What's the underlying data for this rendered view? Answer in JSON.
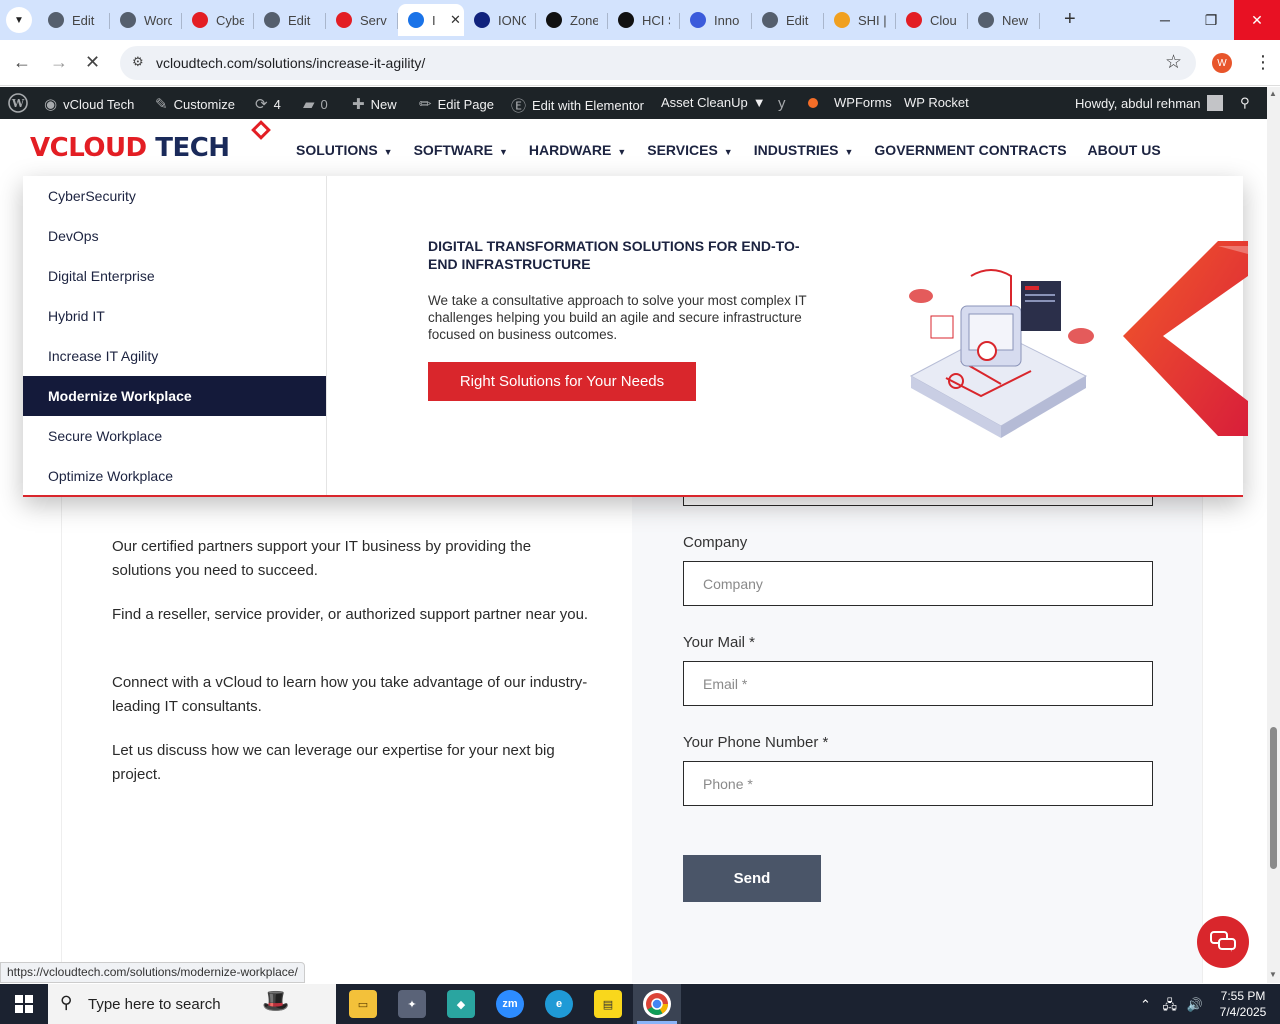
{
  "browser": {
    "tabs": [
      {
        "title": "Edit",
        "icon": "wordpress-icon",
        "color": "#555f6d"
      },
      {
        "title": "Word",
        "icon": "wordpress-icon",
        "color": "#555f6d"
      },
      {
        "title": "Cybe",
        "icon": "vcloud-diamond-icon",
        "color": "#e31e24"
      },
      {
        "title": "Edit",
        "icon": "wordpress-icon",
        "color": "#555f6d"
      },
      {
        "title": "Serv",
        "icon": "vcloud-diamond-icon",
        "color": "#e31e24"
      },
      {
        "title": "I",
        "icon": "loading-icon",
        "color": "#1a73e8",
        "active": true
      },
      {
        "title": "IONC",
        "icon": "ionos-icon",
        "color": "#11237d"
      },
      {
        "title": "Zone",
        "icon": "z-icon",
        "color": "#111111"
      },
      {
        "title": "HCI S",
        "icon": "hci-icon",
        "color": "#111111"
      },
      {
        "title": "Inno",
        "icon": "inno-icon",
        "color": "#3b5bdb"
      },
      {
        "title": "Edit",
        "icon": "wordpress-icon",
        "color": "#555f6d"
      },
      {
        "title": "SHI |",
        "icon": "shi-icon",
        "color": "#f0a020"
      },
      {
        "title": "Clou",
        "icon": "cloud-icon",
        "color": "#e31e24"
      },
      {
        "title": "New",
        "icon": "chrome-icon",
        "color": "#555f6d"
      }
    ],
    "url": "vcloudtech.com/solutions/increase-it-agility/",
    "profile_initial": "W",
    "status_url": "https://vcloudtech.com/solutions/modernize-workplace/"
  },
  "wpbar": {
    "site_name": "vCloud Tech",
    "customize": "Customize",
    "updates_count": "4",
    "comments_count": "0",
    "new": "New",
    "edit_page": "Edit Page",
    "edit_elementor": "Edit with Elementor",
    "asset_cleanup": "Asset CleanUp",
    "wpforms": "WPForms",
    "wp_rocket": "WP Rocket",
    "howdy": "Howdy, abdul rehman"
  },
  "site": {
    "logo_v": "V",
    "logo_cloud": "CLOUD",
    "logo_tech": " TECH",
    "nav": [
      {
        "label": "SOLUTIONS",
        "caret": true
      },
      {
        "label": "SOFTWARE",
        "caret": true
      },
      {
        "label": "HARDWARE",
        "caret": true
      },
      {
        "label": "SERVICES",
        "caret": true
      },
      {
        "label": "INDUSTRIES",
        "caret": true
      },
      {
        "label": "GOVERNMENT CONTRACTS",
        "caret": false
      },
      {
        "label": "ABOUT US",
        "caret": false
      }
    ]
  },
  "megamenu": {
    "items": [
      {
        "label": "CyberSecurity",
        "active": false
      },
      {
        "label": "DevOps",
        "active": false
      },
      {
        "label": "Digital Enterprise",
        "active": false
      },
      {
        "label": "Hybrid IT",
        "active": false
      },
      {
        "label": "Increase IT Agility",
        "active": false
      },
      {
        "label": "Modernize Workplace",
        "active": true
      },
      {
        "label": "Secure Workplace",
        "active": false
      },
      {
        "label": "Optimize Workplace",
        "active": false
      }
    ],
    "heading": "DIGITAL TRANSFORMATION SOLUTIONS FOR END-TO-END INFRASTRUCTURE",
    "description": "We take a consultative approach to solve your most complex IT challenges helping you build an agile and secure infrastructure focused on business outcomes.",
    "cta": "Right Solutions for Your Needs",
    "accent_color": "#d9262c",
    "active_bg": "#141a3a"
  },
  "content": {
    "paragraphs": [
      "Our certified partners support your IT business by providing the solutions you need to succeed.",
      "Find a reseller, service provider, or authorized support partner near you.",
      "Connect with a vCloud to learn how you take advantage of our industry-leading IT consultants.",
      "Let us discuss how we can leverage our expertise for your next big project."
    ],
    "form": {
      "company_label": "Company",
      "company_placeholder": "Company",
      "mail_label": "Your Mail *",
      "mail_placeholder": "Email *",
      "phone_label": "Your Phone Number *",
      "phone_placeholder": "Phone *",
      "send": "Send"
    }
  },
  "taskbar": {
    "search_placeholder": "Type here to search",
    "time": "7:55 PM",
    "date": "7/4/2025",
    "apps": [
      "file-explorer-icon",
      "app-icon",
      "app-icon",
      "zoom-icon",
      "edge-icon",
      "sticky-notes-icon",
      "chrome-icon"
    ]
  }
}
